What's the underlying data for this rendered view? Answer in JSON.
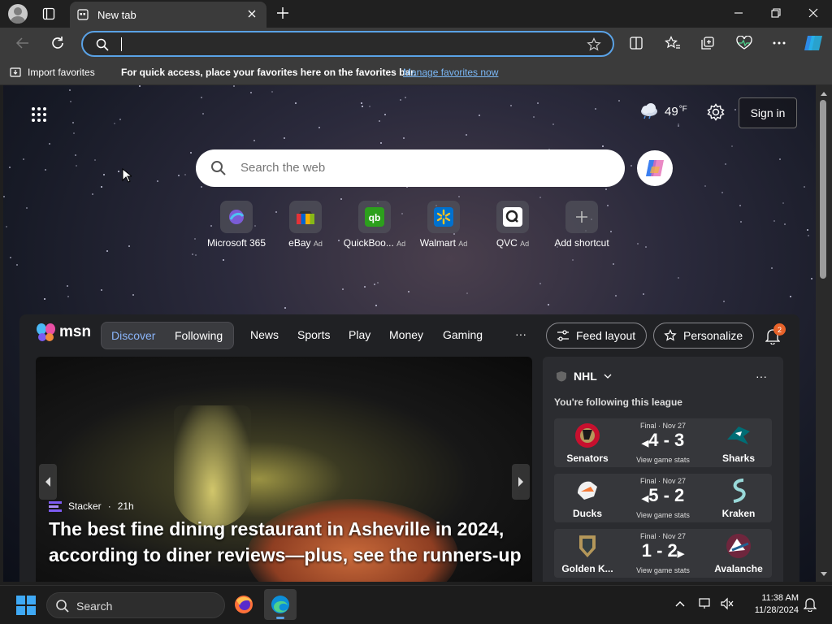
{
  "browser": {
    "tab_title": "New tab",
    "address_value": "",
    "favbar": {
      "import_label": "Import favorites",
      "message": "For quick access, place your favorites here on the favorites bar.",
      "manage_link": "Manage favorites now"
    }
  },
  "newtab": {
    "weather_temp": "49",
    "weather_unit": "°F",
    "signin_label": "Sign in",
    "search_placeholder": "Search the web",
    "quick_links": [
      {
        "label": "Microsoft 365",
        "ad": ""
      },
      {
        "label": "eBay",
        "ad": "Ad"
      },
      {
        "label": "QuickBoo...",
        "ad": "Ad"
      },
      {
        "label": "Walmart",
        "ad": "Ad"
      },
      {
        "label": "QVC",
        "ad": "Ad"
      },
      {
        "label": "Add shortcut",
        "ad": ""
      }
    ]
  },
  "feed": {
    "logo_text": "msn",
    "segment": {
      "discover": "Discover",
      "following": "Following"
    },
    "nav": [
      "News",
      "Sports",
      "Play",
      "Money",
      "Gaming"
    ],
    "nav_more": "···",
    "feed_layout": "Feed layout",
    "personalize": "Personalize",
    "notif_count": "2",
    "hero": {
      "source": "Stacker",
      "age": "21h",
      "headline": "The best fine dining restaurant in Asheville in 2024, according to diner reviews—plus, see the runners-up"
    },
    "nhl": {
      "league": "NHL",
      "more": "···",
      "subtitle": "You're following this league",
      "games": [
        {
          "status": "Final · Nov 27",
          "score": "4 - 3",
          "winner_arrow": "◀",
          "home": "Senators",
          "away": "Sharks",
          "view": "View game stats"
        },
        {
          "status": "Final · Nov 27",
          "score": "5 - 2",
          "winner_arrow": "◀",
          "home": "Ducks",
          "away": "Kraken",
          "view": "View game stats"
        },
        {
          "status": "Final · Nov 27",
          "score": "1 - 2",
          "winner_arrow": "▶",
          "home": "Golden K...",
          "away": "Avalanche",
          "view": "View game stats"
        }
      ]
    }
  },
  "taskbar": {
    "search_label": "Search",
    "time": "11:38 AM",
    "date": "11/28/2024"
  },
  "colors": {
    "accent": "#5aa2e6",
    "link": "#7ab7f5",
    "badge": "#e8632a"
  }
}
